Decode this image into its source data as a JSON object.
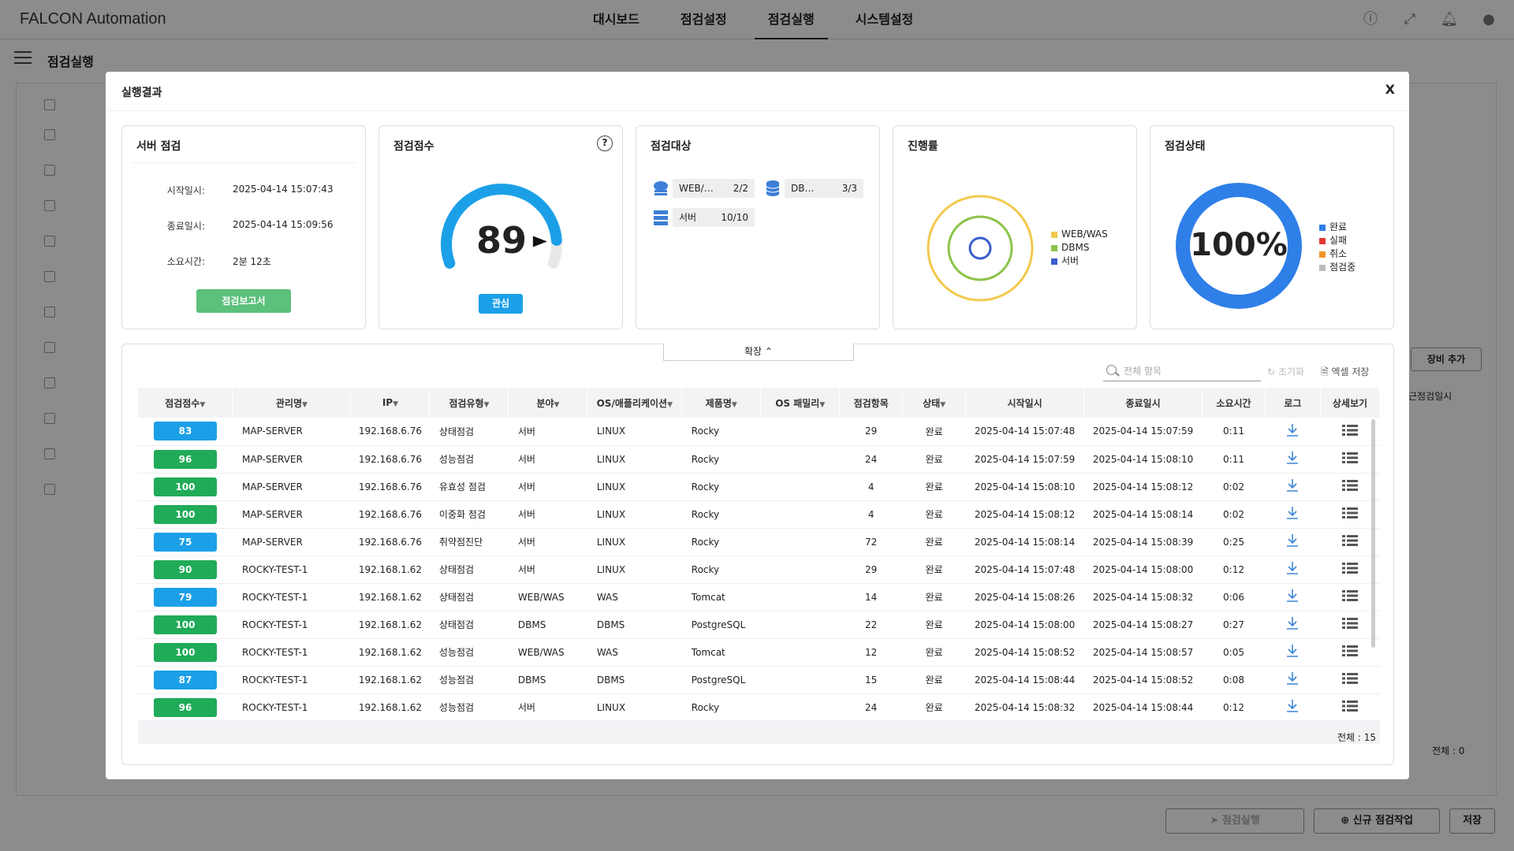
{
  "app": {
    "title": "FALCON Automation"
  },
  "nav": [
    "대시보드",
    "점검설정",
    "점검실행",
    "시스템설정"
  ],
  "nav_active": "점검실행",
  "page": {
    "title": "점검실행"
  },
  "background": {
    "add_device": "장비 추가",
    "last_inspect_col": "근점검일시",
    "total": "전체 : 0",
    "run_button": "점검실행",
    "new_job_button": "신규 점검작업",
    "save_button": "저장"
  },
  "modal": {
    "title": "실행결과",
    "close": "X",
    "server_check": {
      "title": "서버 점검",
      "start_label": "시작일시:",
      "start_value": "2025-04-14 15:07:43",
      "end_label": "종료일시:",
      "end_value": "2025-04-14 15:09:56",
      "duration_label": "소요시간:",
      "duration_value": "2분 12초",
      "report_button": "점검보고서"
    },
    "score": {
      "title": "점검점수",
      "value": "89",
      "level": "관심",
      "gauge_fraction": 0.89,
      "help": "?"
    },
    "targets": {
      "title": "점검대상",
      "items": [
        {
          "label": "WEB/…",
          "count": "2/2",
          "icon": "cloud-server-icon"
        },
        {
          "label": "DB…",
          "count": "3/3",
          "icon": "database-icon"
        },
        {
          "label": "서버",
          "count": "10/10",
          "icon": "server-icon"
        }
      ]
    },
    "progress": {
      "title": "진행률",
      "legend": [
        {
          "label": "WEB/WAS",
          "color": "#f2c94c"
        },
        {
          "label": "DBMS",
          "color": "#8bc34a"
        },
        {
          "label": "서버",
          "color": "#3a5fcd"
        }
      ]
    },
    "status": {
      "title": "점검상태",
      "value": "100%",
      "legend": [
        {
          "label": "완료",
          "color": "#2f7fe8"
        },
        {
          "label": "실패",
          "color": "#e53935"
        },
        {
          "label": "취소",
          "color": "#f0962a"
        },
        {
          "label": "점검중",
          "color": "#bbbbbb"
        }
      ]
    },
    "table": {
      "expand": "확장",
      "search_placeholder": "전체 항목",
      "reset": "초기화",
      "excel": "엑셀 저장",
      "columns": [
        "점검점수",
        "관리명",
        "IP",
        "점검유형",
        "분야",
        "OS/애플리케이션",
        "제품명",
        "OS 패밀리",
        "점검항목",
        "상태",
        "시작일시",
        "종료일시",
        "소요시간",
        "로그",
        "상세보기"
      ],
      "rows": [
        {
          "score": "83",
          "name": "MAP-SERVER",
          "ip": "192.168.6.76",
          "type": "상태점검",
          "field": "서버",
          "os": "LINUX",
          "product": "Rocky",
          "family": "",
          "items": "29",
          "status": "완료",
          "start": "2025-04-14 15:07:48",
          "end": "2025-04-14 15:07:59",
          "dur": "0:11"
        },
        {
          "score": "96",
          "name": "MAP-SERVER",
          "ip": "192.168.6.76",
          "type": "성능점검",
          "field": "서버",
          "os": "LINUX",
          "product": "Rocky",
          "family": "",
          "items": "24",
          "status": "완료",
          "start": "2025-04-14 15:07:59",
          "end": "2025-04-14 15:08:10",
          "dur": "0:11"
        },
        {
          "score": "100",
          "name": "MAP-SERVER",
          "ip": "192.168.6.76",
          "type": "유효성 점검",
          "field": "서버",
          "os": "LINUX",
          "product": "Rocky",
          "family": "",
          "items": "4",
          "status": "완료",
          "start": "2025-04-14 15:08:10",
          "end": "2025-04-14 15:08:12",
          "dur": "0:02"
        },
        {
          "score": "100",
          "name": "MAP-SERVER",
          "ip": "192.168.6.76",
          "type": "이중화 점검",
          "field": "서버",
          "os": "LINUX",
          "product": "Rocky",
          "family": "",
          "items": "4",
          "status": "완료",
          "start": "2025-04-14 15:08:12",
          "end": "2025-04-14 15:08:14",
          "dur": "0:02"
        },
        {
          "score": "75",
          "name": "MAP-SERVER",
          "ip": "192.168.6.76",
          "type": "취약점진단",
          "field": "서버",
          "os": "LINUX",
          "product": "Rocky",
          "family": "",
          "items": "72",
          "status": "완료",
          "start": "2025-04-14 15:08:14",
          "end": "2025-04-14 15:08:39",
          "dur": "0:25"
        },
        {
          "score": "90",
          "name": "ROCKY-TEST-1",
          "ip": "192.168.1.62",
          "type": "상태점검",
          "field": "서버",
          "os": "LINUX",
          "product": "Rocky",
          "family": "",
          "items": "29",
          "status": "완료",
          "start": "2025-04-14 15:07:48",
          "end": "2025-04-14 15:08:00",
          "dur": "0:12"
        },
        {
          "score": "79",
          "name": "ROCKY-TEST-1",
          "ip": "192.168.1.62",
          "type": "상태점검",
          "field": "WEB/WAS",
          "os": "WAS",
          "product": "Tomcat",
          "family": "",
          "items": "14",
          "status": "완료",
          "start": "2025-04-14 15:08:26",
          "end": "2025-04-14 15:08:32",
          "dur": "0:06"
        },
        {
          "score": "100",
          "name": "ROCKY-TEST-1",
          "ip": "192.168.1.62",
          "type": "상태점검",
          "field": "DBMS",
          "os": "DBMS",
          "product": "PostgreSQL",
          "family": "",
          "items": "22",
          "status": "완료",
          "start": "2025-04-14 15:08:00",
          "end": "2025-04-14 15:08:27",
          "dur": "0:27"
        },
        {
          "score": "100",
          "name": "ROCKY-TEST-1",
          "ip": "192.168.1.62",
          "type": "성능점검",
          "field": "WEB/WAS",
          "os": "WAS",
          "product": "Tomcat",
          "family": "",
          "items": "12",
          "status": "완료",
          "start": "2025-04-14 15:08:52",
          "end": "2025-04-14 15:08:57",
          "dur": "0:05"
        },
        {
          "score": "87",
          "name": "ROCKY-TEST-1",
          "ip": "192.168.1.62",
          "type": "성능점검",
          "field": "DBMS",
          "os": "DBMS",
          "product": "PostgreSQL",
          "family": "",
          "items": "15",
          "status": "완료",
          "start": "2025-04-14 15:08:44",
          "end": "2025-04-14 15:08:52",
          "dur": "0:08"
        },
        {
          "score": "96",
          "name": "ROCKY-TEST-1",
          "ip": "192.168.1.62",
          "type": "성능점검",
          "field": "서버",
          "os": "LINUX",
          "product": "Rocky",
          "family": "",
          "items": "24",
          "status": "완료",
          "start": "2025-04-14 15:08:32",
          "end": "2025-04-14 15:08:44",
          "dur": "0:12"
        }
      ],
      "total": "전체 : 15"
    }
  },
  "colors": {
    "score_high": "#1fab58",
    "score_mid": "#1ba0e8"
  }
}
